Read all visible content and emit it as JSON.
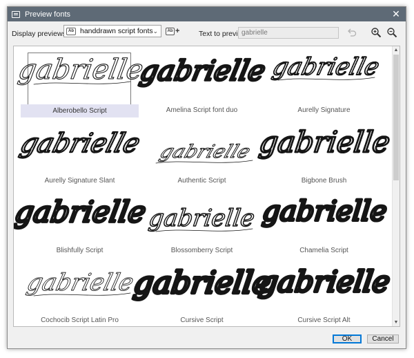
{
  "window": {
    "title": "Preview fonts",
    "close_glyph": "✕"
  },
  "toolbar": {
    "display_label": "Display previews for:",
    "combo_icon": "Ab",
    "combo_value": "handdrawn script fonts",
    "combo_arrow": "⌄",
    "add_icon": "Ab",
    "add_plus": "+",
    "text_label": "Text to preview:",
    "text_value": "gabrielle",
    "icons": {
      "reset": "undo-icon",
      "zoom_in": "zoom-in-icon",
      "zoom_out": "zoom-out-icon"
    }
  },
  "preview_text": "gabrielle",
  "fonts": [
    {
      "name": "Alberobello Script",
      "selected": true
    },
    {
      "name": "Amelina Script font duo",
      "selected": false
    },
    {
      "name": "Aurelly Signature",
      "selected": false
    },
    {
      "name": "Aurelly Signature Slant",
      "selected": false
    },
    {
      "name": "Authentic Script",
      "selected": false
    },
    {
      "name": "Bigbone Brush",
      "selected": false
    },
    {
      "name": "Blishfully Script",
      "selected": false
    },
    {
      "name": "Blossomberry Script",
      "selected": false
    },
    {
      "name": "Chamelia Script",
      "selected": false
    },
    {
      "name": "Cochocib Script Latin Pro",
      "selected": false
    },
    {
      "name": "Cursive Script",
      "selected": false
    },
    {
      "name": "Cursive Script Alt",
      "selected": false
    }
  ],
  "scrollbar": {
    "up_glyph": "▲",
    "down_glyph": "▼"
  },
  "buttons": {
    "ok": "OK",
    "cancel": "Cancel"
  },
  "colors": {
    "titlebar": "#5e6a76",
    "selection": "#e2e2f2",
    "ok_border": "#0078d7"
  }
}
